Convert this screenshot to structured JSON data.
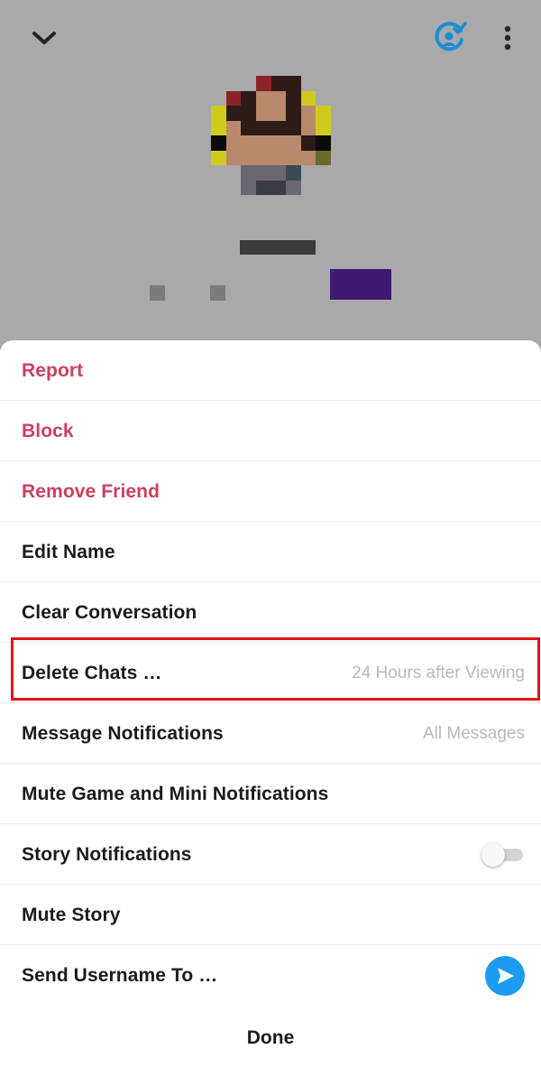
{
  "header": {
    "collapse_icon": "chevron-down-icon",
    "spectacles_icon": "spectacles-check-icon",
    "more_icon": "vertical-dots-icon"
  },
  "menu": {
    "items": [
      {
        "label": "Report",
        "tone": "danger"
      },
      {
        "label": "Block",
        "tone": "danger"
      },
      {
        "label": "Remove Friend",
        "tone": "danger"
      },
      {
        "label": "Edit Name"
      },
      {
        "label": "Clear Conversation"
      },
      {
        "label": "Delete Chats …",
        "value": "24 Hours after Viewing",
        "highlighted": true
      },
      {
        "label": "Message Notifications",
        "value": "All Messages"
      },
      {
        "label": "Mute Game and Mini Notifications"
      },
      {
        "label": "Story Notifications",
        "toggle": false
      },
      {
        "label": "Mute Story"
      },
      {
        "label": "Send Username To …",
        "icon": "send-arrow-icon"
      }
    ],
    "done_label": "Done"
  },
  "colors": {
    "danger": "#cf3f5d",
    "highlight_border": "#e2131c",
    "send_button": "#1b9cf0",
    "overlay": "#a9a9ab"
  }
}
